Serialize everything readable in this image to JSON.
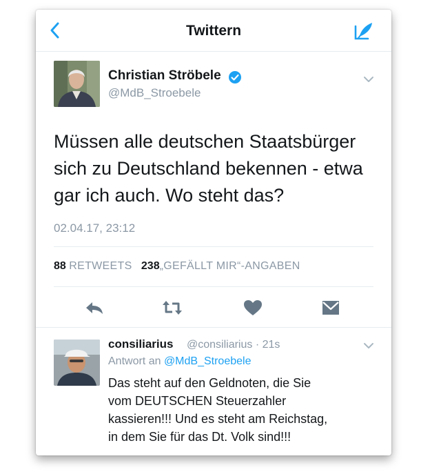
{
  "header": {
    "title": "Twittern"
  },
  "colors": {
    "accent": "#1da1f2",
    "secondary_text": "#8b98a5",
    "divider": "#e6ecf0"
  },
  "icons": {
    "back": "chevron-left-icon",
    "compose": "compose-tweet-icon",
    "verified": "verified-badge-icon",
    "more": "chevron-down-icon",
    "actions": [
      "reply-icon",
      "retweet-icon",
      "heart-icon",
      "direct-message-icon"
    ]
  },
  "tweet": {
    "author_name": "Christian Ströbele",
    "author_handle": "@MdB_Stroebele",
    "text": "Müssen alle deutschen Staatsbürger\nsich zu Deutschland  bekennen - etwa\ngar ich auch. Wo steht das?",
    "timestamp": "02.04.17, 23:12",
    "retweets_count": "88",
    "retweets_label": "RETWEETS",
    "likes_count": "238",
    "likes_label": "„GEFÄLLT MIR“-ANGABEN"
  },
  "reply": {
    "author_name": "consiliarius",
    "author_handle": "@consiliarius",
    "separator": "·",
    "time_ago": "21s",
    "reply_to_label": "Antwort an",
    "reply_to_handle": "@MdB_Stroebele",
    "text": "Das steht auf den Geldnoten, die Sie\nvom DEUTSCHEN Steuerzahler\nkassieren!!! Und es steht am Reichstag,\nin dem Sie für das Dt. Volk sind!!!"
  }
}
